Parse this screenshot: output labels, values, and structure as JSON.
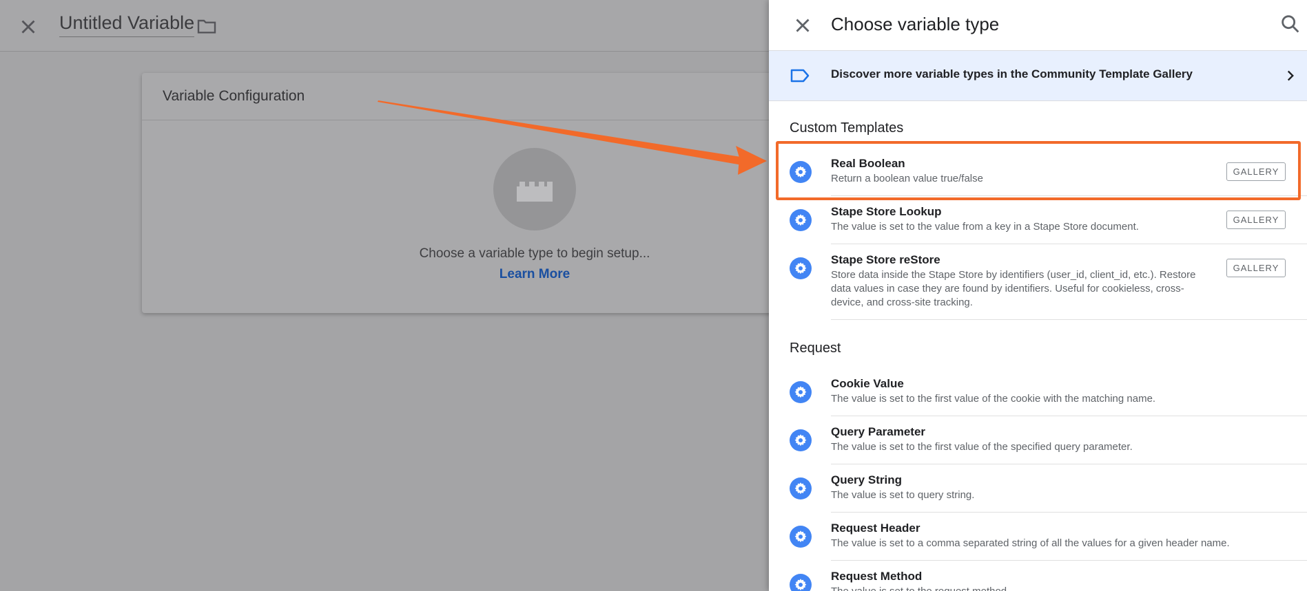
{
  "background": {
    "title": "Untitled Variable",
    "close_icon": "close-icon",
    "folder_icon": "folder-icon",
    "card": {
      "title": "Variable Configuration",
      "placeholder_icon": "lego-brick-icon",
      "prompt": "Choose a variable type to begin setup...",
      "link": "Learn More"
    }
  },
  "panel": {
    "title": "Choose variable type",
    "search_icon": "search-icon",
    "banner": {
      "icon": "label-tag-icon",
      "text": "Discover more variable types in the Community Template Gallery"
    },
    "custom_templates": {
      "title": "Custom Templates",
      "items": [
        {
          "name": "Real Boolean",
          "desc": "Return a boolean value true/false",
          "button": "GALLERY"
        },
        {
          "name": "Stape Store Lookup",
          "desc": "The value is set to the value from a key in a Stape Store document.",
          "button": "GALLERY"
        },
        {
          "name": "Stape Store reStore",
          "desc": "Store data inside the Stape Store by identifiers (user_id, client_id, etc.). Restore data values in case they are found by identifiers. Useful for cookieless, cross-device, and cross-site tracking.",
          "button": "GALLERY"
        }
      ]
    },
    "request": {
      "title": "Request",
      "items": [
        {
          "name": "Cookie Value",
          "desc": "The value is set to the first value of the cookie with the matching name."
        },
        {
          "name": "Query Parameter",
          "desc": "The value is set to the first value of the specified query parameter."
        },
        {
          "name": "Query String",
          "desc": "The value is set to query string."
        },
        {
          "name": "Request Header",
          "desc": "The value is set to a comma separated string of all the values for a given header name."
        },
        {
          "name": "Request Method",
          "desc": "The value is set to the request method."
        }
      ]
    }
  },
  "colors": {
    "accent_blue": "#4285f4",
    "highlight_orange": "#f26a2a",
    "banner_bg": "#e8f0fe"
  }
}
